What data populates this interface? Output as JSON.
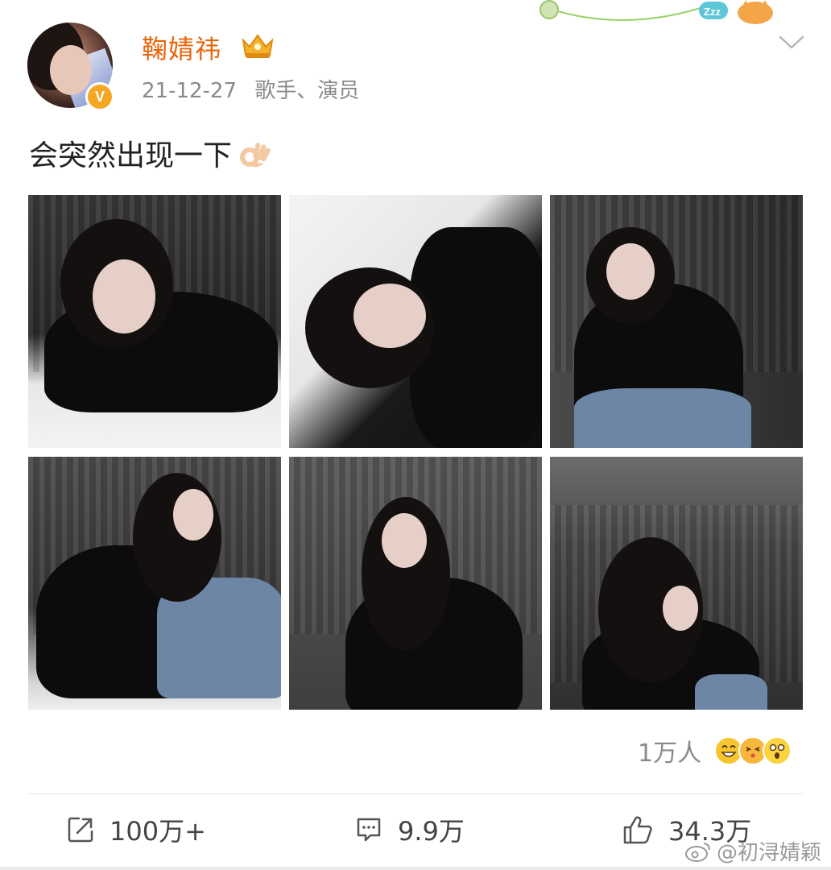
{
  "author": {
    "name": "鞠婧祎",
    "verified": true,
    "badge_letter": "V",
    "date": "21-12-27",
    "bio": "歌手、演员"
  },
  "post": {
    "text": "会突然出现一下",
    "emoji": "ok-hand-icon"
  },
  "photos": [
    {
      "id": "photo-1"
    },
    {
      "id": "photo-2"
    },
    {
      "id": "photo-3"
    },
    {
      "id": "photo-4"
    },
    {
      "id": "photo-5"
    },
    {
      "id": "photo-6"
    }
  ],
  "reactions": {
    "count": "1万人",
    "emojis": [
      "laugh-icon",
      "kiss-icon",
      "surprise-icon"
    ]
  },
  "actions": {
    "share": "100万+",
    "comment": "9.9万",
    "like": "34.3万"
  },
  "watermark": "@初浔婧颖",
  "colors": {
    "username": "#e8650a",
    "badge": "#f5a623",
    "meta": "#8a8a8a"
  }
}
